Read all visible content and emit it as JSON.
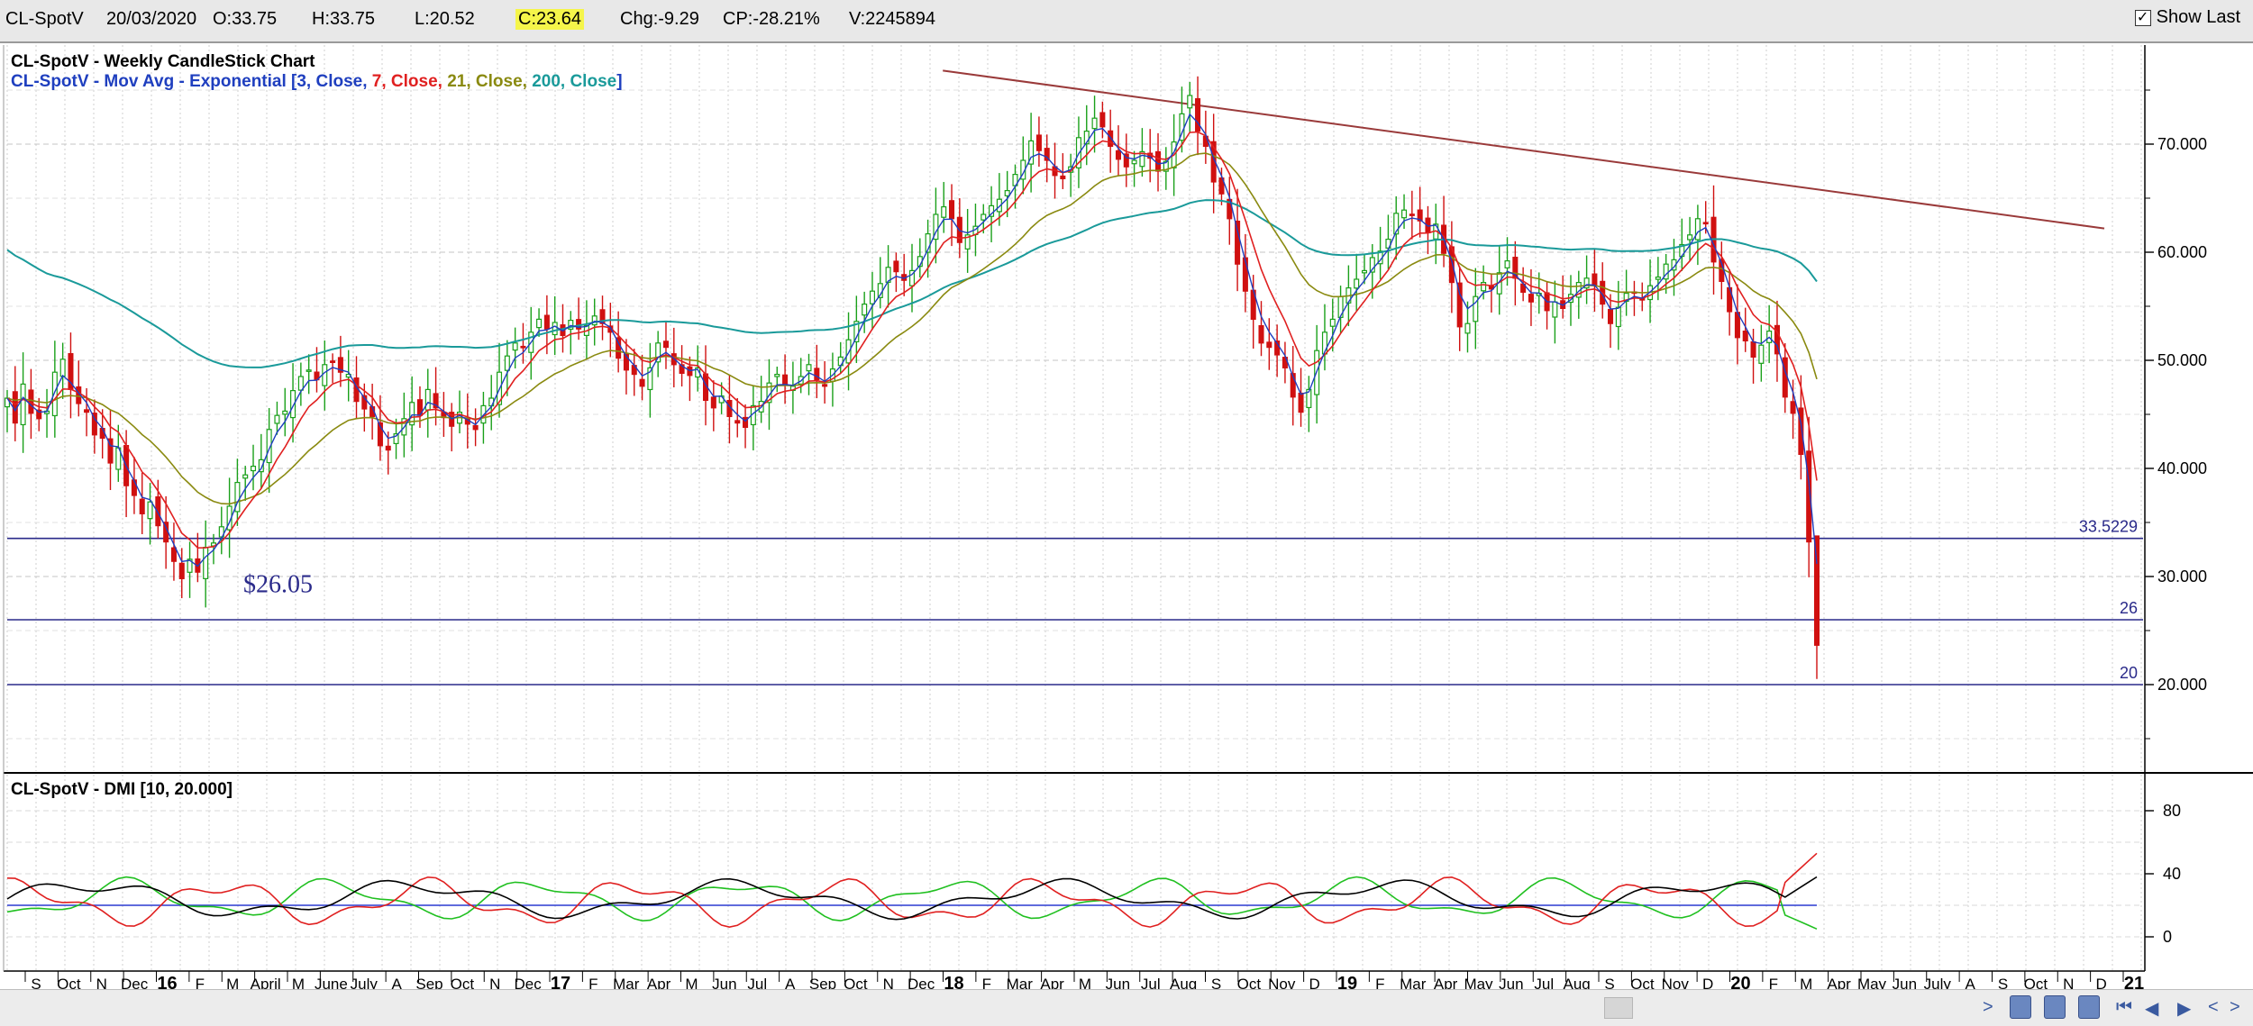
{
  "infobar": {
    "symbol": "CL-SpotV",
    "date": "20/03/2020",
    "open": "O:33.75",
    "high": "H:33.75",
    "low": "L:20.52",
    "close": "C:23.64",
    "change": "Chg:-9.29",
    "change_pct": "CP:-28.21%",
    "volume": "V:2245894",
    "show_last_label": "Show Last",
    "show_last_checked": true
  },
  "chart_data": [
    {
      "type": "candlestick",
      "title": "CL-SpotV - Weekly CandleStick Chart",
      "overlay_title_prefix": "CL-SpotV - Mov Avg - Exponential [",
      "overlay_params": [
        {
          "text": "3, Close, ",
          "color": "#1f3fbf"
        },
        {
          "text": "7, Close, ",
          "color": "#e02020"
        },
        {
          "text": "21, Close, ",
          "color": "#8a8a10"
        },
        {
          "text": "200, Close",
          "color": "#1a9a9a"
        }
      ],
      "overlay_title_suffix": "]",
      "ylim": [
        14,
        78
      ],
      "y_ticks": [
        "20.000",
        "30.000",
        "40.000",
        "50.000",
        "60.000",
        "70.000"
      ],
      "x_tick_labels": [
        "S",
        "Oct",
        "N",
        "Dec",
        "16",
        "F",
        "M",
        "April",
        "M",
        "June",
        "July",
        "A",
        "Sep",
        "Oct",
        "N",
        "Dec",
        "17",
        "F",
        "Mar",
        "Apr",
        "M",
        "Jun",
        "Jul",
        "A",
        "Sep",
        "Oct",
        "N",
        "Dec",
        "18",
        "F",
        "Mar",
        "Apr",
        "M",
        "Jun",
        "Jul",
        "Aug",
        "S",
        "Oct",
        "Nov",
        "D",
        "19",
        "F",
        "Mar",
        "Apr",
        "May",
        "Jun",
        "Jul",
        "Aug",
        "S",
        "Oct",
        "Nov",
        "D",
        "20",
        "F",
        "M",
        "Apr",
        "May",
        "Jun",
        "July",
        "A",
        "S",
        "Oct",
        "N",
        "D",
        "21"
      ],
      "x_range": [
        "2015-08",
        "2021-01"
      ],
      "ema_periods": [
        3,
        7,
        21,
        200
      ],
      "series_colors": {
        "ema3": "#1f3fbf",
        "ema7": "#e02020",
        "ema21": "#8a8a10",
        "ema200": "#1a9a9a",
        "up": "#1aa01a",
        "down": "#d01010"
      },
      "weekly_close": [
        46.5,
        44.2,
        47.8,
        45.1,
        44.6,
        45.3,
        48.9,
        50.1,
        47.3,
        46.0,
        45.2,
        43.1,
        42.8,
        40.5,
        41.9,
        38.4,
        37.5,
        35.8,
        36.9,
        34.7,
        33.2,
        31.4,
        29.8,
        31.6,
        30.4,
        32.7,
        33.1,
        34.6,
        36.5,
        38.7,
        39.4,
        40.2,
        40.8,
        43.6,
        44.9,
        45.3,
        47.2,
        48.5,
        49.1,
        48.2,
        49.6,
        49.8,
        48.9,
        48.7,
        46.2,
        45.5,
        44.8,
        42.1,
        41.7,
        43.2,
        44.6,
        46.1,
        44.9,
        47.3,
        45.6,
        44.7,
        43.9,
        45.2,
        44.1,
        43.6,
        45.8,
        46.5,
        48.9,
        50.4,
        51.6,
        51.2,
        52.6,
        53.8,
        52.9,
        53.5,
        52.3,
        53.7,
        52.9,
        53.2,
        54.1,
        53.4,
        52.6,
        50.2,
        49.1,
        48.7,
        47.6,
        49.3,
        51.6,
        51.2,
        49.6,
        48.8,
        48.6,
        49.3,
        46.3,
        45.6,
        46.7,
        44.8,
        44.2,
        43.8,
        45.8,
        46.2,
        47.9,
        48.7,
        47.8,
        47.6,
        48.5,
        49.6,
        48.2,
        47.6,
        49.2,
        50.3,
        51.9,
        53.6,
        55.2,
        56.4,
        57.1,
        58.6,
        58.2,
        57.4,
        58.3,
        59.6,
        61.7,
        63.5,
        64.2,
        63.1,
        60.9,
        61.6,
        62.4,
        63.5,
        64.3,
        64.9,
        65.7,
        67.2,
        68.5,
        70.3,
        69.4,
        68.5,
        67.1,
        66.8,
        67.9,
        70.6,
        71.2,
        72.4,
        71.6,
        69.8,
        68.6,
        67.9,
        68.5,
        69.3,
        68.7,
        67.5,
        68.4,
        70.2,
        72.8,
        74.5,
        71.2,
        69.8,
        66.5,
        65.4,
        63.1,
        58.9,
        56.4,
        53.8,
        51.6,
        51.2,
        50.5,
        49.3,
        46.6,
        45.2,
        47.3,
        50.9,
        52.6,
        53.8,
        55.9,
        56.7,
        57.5,
        58.3,
        59.5,
        60.1,
        61.2,
        63.6,
        63.9,
        63.4,
        62.9,
        61.8,
        62.6,
        59.9,
        57.2,
        53.1,
        53.4,
        55.9,
        57.2,
        56.6,
        58.1,
        59.2,
        57.6,
        56.3,
        55.4,
        56.2,
        54.6,
        55.4,
        54.8,
        56.1,
        57.2,
        57.6,
        56.9,
        55.2,
        53.4,
        54.9,
        56.2,
        56.3,
        55.6,
        56.9,
        57.7,
        58.9,
        59.3,
        60.7,
        61.6,
        63.1,
        62.7,
        59.1,
        57.3,
        54.5,
        52.1,
        51.8,
        50.3,
        51.4,
        52.7,
        50.6,
        46.6,
        45.1,
        41.3,
        33.2,
        23.64
      ],
      "hlines": [
        {
          "value": 33.5229,
          "label": "33.5229",
          "color": "#2a2a8a"
        },
        {
          "value": 26,
          "label": "26",
          "color": "#2a2a8a"
        },
        {
          "value": 20,
          "label": "20",
          "color": "#2a2a8a"
        }
      ],
      "annotation": {
        "text": "$26.05",
        "value": 26.05,
        "color": "#2a2a8a"
      },
      "trendline": {
        "color": "#9a3a3a",
        "start": {
          "date": "2018-01",
          "value": 76.8
        },
        "end": {
          "date": "2021-01",
          "value": 62.2
        }
      }
    },
    {
      "type": "line",
      "title": "CL-SpotV - DMI [10, 20.000]",
      "ylim": [
        -10,
        90
      ],
      "y_ticks": [
        "0",
        "40",
        "80"
      ],
      "reference_line": {
        "value": 20,
        "color": "#2a3ad0"
      },
      "series_colors": {
        "adx": "#000000",
        "plus_di": "#e02020",
        "minus_di": "#20c020"
      }
    }
  ],
  "scrollbar": {
    "left_arrow": "<",
    "right_arrow": ">",
    "nav_left": "◀",
    "nav_right": "▶"
  }
}
